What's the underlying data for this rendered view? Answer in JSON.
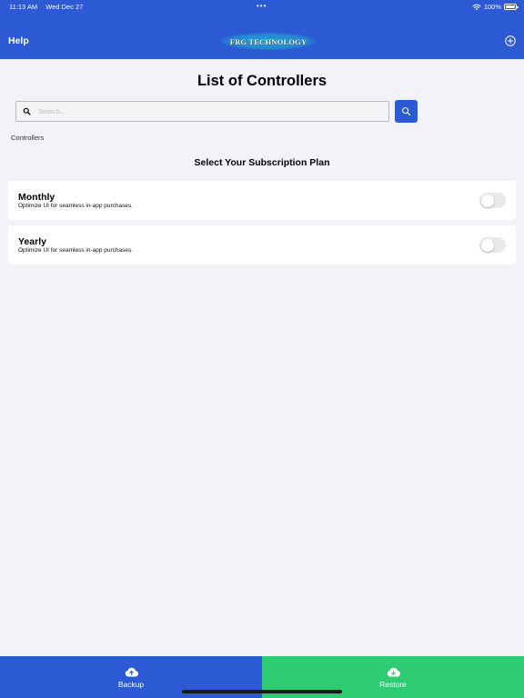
{
  "status_bar": {
    "time": "11:13 AM",
    "date": "Wed Dec 27",
    "dots": "•••",
    "battery": "100%"
  },
  "header": {
    "help_label": "Help",
    "logo_text": "FRG TECHNOLOGY",
    "background_color": "#2c5ad4"
  },
  "main": {
    "title": "List of Controllers",
    "search": {
      "placeholder": "Search...",
      "value": ""
    },
    "section_label": "Controllers",
    "plan_heading": "Select Your Subscription Plan",
    "plans": [
      {
        "title": "Monthly",
        "description": "Optimize UI for seamless in-app purchases.",
        "enabled": false
      },
      {
        "title": "Yearly",
        "description": "Optimize UI for seamless in-app purchases.",
        "enabled": false
      }
    ]
  },
  "bottom_bar": {
    "backup_label": "Backup",
    "restore_label": "Restore",
    "backup_color": "#2c5ad4",
    "restore_color": "#2ecc71"
  },
  "icons": {
    "add": "plus-circle-icon",
    "search": "magnifier-icon",
    "backup": "cloud-upload-icon",
    "restore": "cloud-download-icon"
  }
}
